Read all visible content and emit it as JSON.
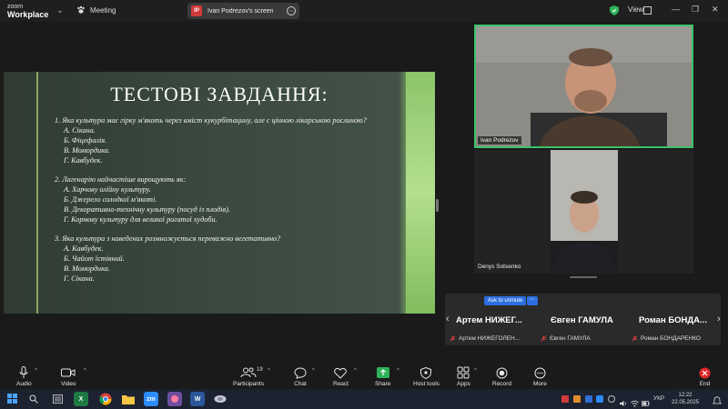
{
  "titlebar": {
    "logo_line1": "zoom",
    "logo_line2": "Workplace",
    "meeting_label": "Meeting",
    "badge": "IP",
    "share_title": "Ivan Podrezov's screen",
    "view_label": "View",
    "more_glyph": "⋯"
  },
  "slide": {
    "title": "ТЕСТОВІ ЗАВДАННЯ:",
    "questions": [
      {
        "q": "1. Яка культура має гірку м'якоть через вміст кукурбітацину, але є цінною лікарською рослиною?",
        "options": [
          "А. Сікана.",
          "Б. Фіцефалія.",
          "В. Момордика.",
          "Г. Кавбудек."
        ]
      },
      {
        "q": "2. Лагенарію найчастіше вирощують як:",
        "options": [
          "А. Харчову олійну культуру.",
          "Б. Джерело солодкої м'якоті.",
          "В. Декоративно-технічну культуру (посуд із плодів).",
          "Г. Кормову культуру для великої рогатої худоби."
        ]
      },
      {
        "q": "3. Яка культура з наведених розмножується переважно вегетативно?",
        "options": [
          "А. Кавбудек.",
          "Б. Чайот їстівний.",
          "В. Момордика.",
          "Г. Сікана."
        ]
      }
    ]
  },
  "participants_video": {
    "ivan": "Ivan Podrezov",
    "denys": "Denys Sotsenko"
  },
  "strip": {
    "ask_to_unmute": "Ask to unmute",
    "more": "⋯",
    "people": [
      {
        "big": "Артем НИЖЕГ...",
        "small": "Артем НИЖЕГОЛЕН..."
      },
      {
        "big": "Євген ГАМУЛА",
        "small": "Євген ГАМУЛА"
      },
      {
        "big": "Роман  БОНДА...",
        "small": "Роман БОНДАРЕНКО"
      }
    ]
  },
  "toolbar": {
    "audio": "Audio",
    "video": "Video",
    "participants": "Participants",
    "participants_count": "19",
    "chat": "Chat",
    "react": "React",
    "share": "Share",
    "host_tools": "Host tools",
    "apps": "Apps",
    "record": "Record",
    "more": "More",
    "end": "End"
  },
  "taskbar": {
    "lang": "УКР",
    "time": "12:22",
    "date": "22.05.2025",
    "zm": "zm",
    "excel": "X",
    "word": "W"
  },
  "colors": {
    "accent_green": "#39c36b",
    "unmute_blue": "#2d6fe0",
    "end_red": "#e02828"
  }
}
